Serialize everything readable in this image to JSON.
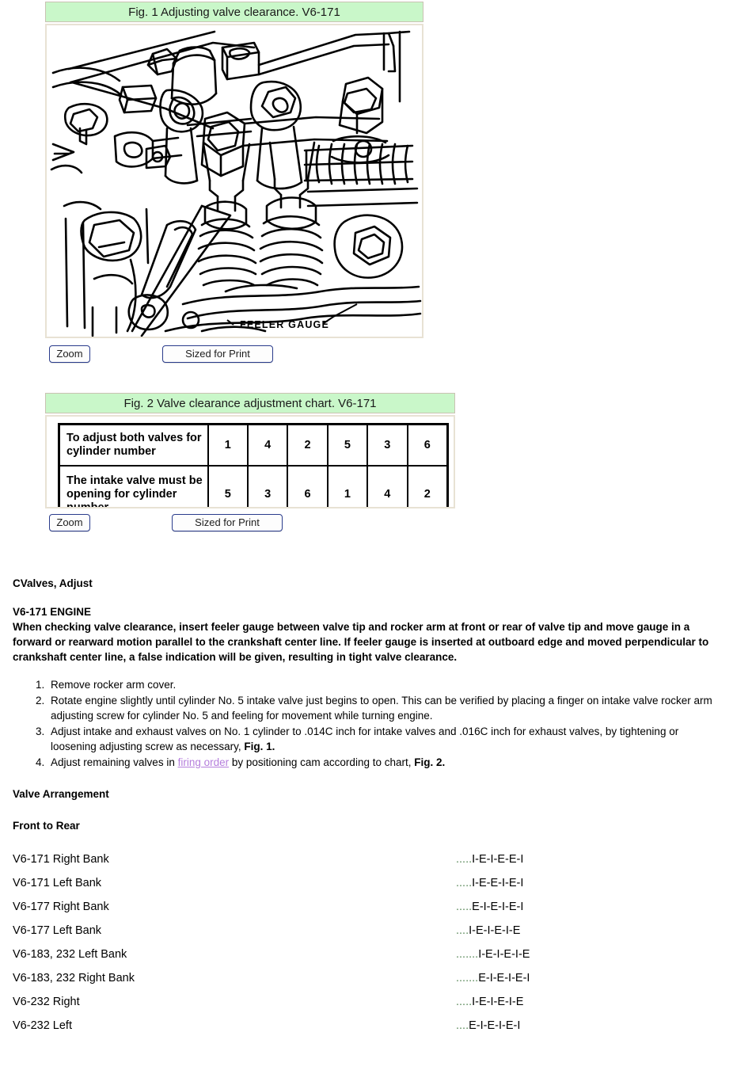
{
  "figures": [
    {
      "id": "fig1",
      "caption": "Fig. 1 Adjusting valve clearance. V6-171",
      "artwork_label": "FEELER GAUGE",
      "buttons": {
        "zoom": "Zoom",
        "print": "Sized for Print"
      }
    },
    {
      "id": "fig2",
      "caption": "Fig. 2 Valve clearance adjustment chart. V6-171",
      "buttons": {
        "zoom": "Zoom",
        "print": "Sized for Print"
      }
    }
  ],
  "chart_data": {
    "type": "table",
    "title": "Fig. 2 Valve clearance adjustment chart. V6-171",
    "rows": [
      {
        "label": "To adjust both valves for cylinder number",
        "values": [
          "1",
          "4",
          "2",
          "5",
          "3",
          "6"
        ]
      },
      {
        "label": "The intake valve must be opening for cylinder number",
        "values": [
          "5",
          "3",
          "6",
          "1",
          "4",
          "2"
        ]
      }
    ]
  },
  "document": {
    "topic_title": "CValves, Adjust",
    "engine_heading": "V6-171 ENGINE",
    "intro_paragraph": "When checking valve clearance, insert feeler gauge between valve tip and rocker arm at front or rear of valve tip and move gauge in a forward or rearward motion parallel to the crankshaft center line. If feeler gauge is inserted at outboard edge and moved perpendicular to crankshaft center line, a false indication will be given, resulting in tight valve clearance.",
    "steps": [
      {
        "parts": [
          {
            "t": "text",
            "v": "Remove rocker arm cover."
          }
        ]
      },
      {
        "parts": [
          {
            "t": "text",
            "v": "Rotate engine slightly until cylinder No. 5 intake valve just begins to open. This can be verified by placing a finger on intake valve rocker arm adjusting screw for cylinder No. 5 and feeling for movement while turning engine."
          }
        ]
      },
      {
        "parts": [
          {
            "t": "text",
            "v": "Adjust intake and exhaust valves on No. 1 cylinder to .014C inch for intake valves and .016C inch for exhaust valves, by tightening or loosening adjusting screw as necessary, "
          },
          {
            "t": "bold",
            "v": "Fig. 1."
          }
        ]
      },
      {
        "parts": [
          {
            "t": "text",
            "v": "Adjust remaining valves in "
          },
          {
            "t": "link",
            "v": "firing order"
          },
          {
            "t": "text",
            "v": " by positioning cam according to chart, "
          },
          {
            "t": "bold",
            "v": "Fig. 2."
          }
        ]
      }
    ],
    "valve_arrangement_heading": "Valve Arrangement",
    "front_to_rear_heading": "Front to Rear",
    "valve_arrangement": [
      {
        "label": "V6-171 Right Bank",
        "dots": ".....",
        "value": "I-E-I-E-E-I"
      },
      {
        "label": "V6-171 Left Bank",
        "dots": ".....",
        "value": "I-E-E-I-E-I"
      },
      {
        "label": "V6-177 Right Bank",
        "dots": ".....",
        "value": "E-I-E-I-E-I"
      },
      {
        "label": "V6-177 Left Bank",
        "dots": "....",
        "value": "I-E-I-E-I-E"
      },
      {
        "label": "V6-183, 232 Left Bank",
        "dots": ".......",
        "value": "I-E-I-E-I-E"
      },
      {
        "label": "V6-183, 232 Right Bank",
        "dots": ".......",
        "value": "E-I-E-I-E-I"
      },
      {
        "label": "V6-232 Right",
        "dots": ".....",
        "value": "I-E-I-E-I-E"
      },
      {
        "label": "V6-232 Left",
        "dots": "....",
        "value": "E-I-E-I-E-I"
      }
    ]
  },
  "colors": {
    "caption_background": "#c9f7c9",
    "figure_border": "#e8e2d4",
    "button_border": "#2a3c8c",
    "link": "#b57edc",
    "dot_leader": "#5a8a5a"
  }
}
